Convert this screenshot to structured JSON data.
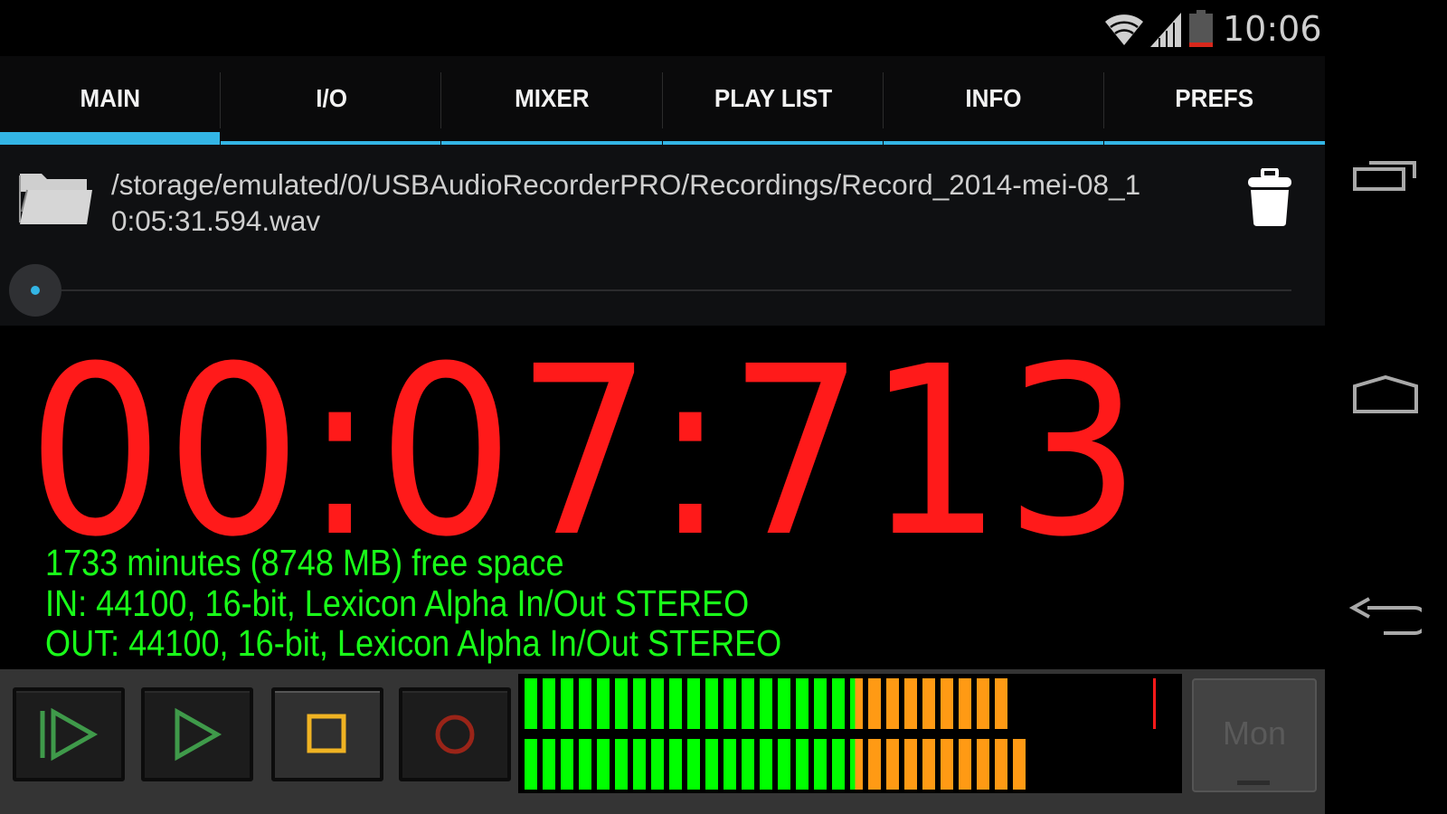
{
  "status_bar": {
    "time": "10:06",
    "icons": [
      "wifi-icon",
      "cell-signal-icon",
      "battery-low-icon"
    ]
  },
  "tabs": [
    {
      "label": "MAIN",
      "active": true
    },
    {
      "label": "I/O",
      "active": false
    },
    {
      "label": "MIXER",
      "active": false
    },
    {
      "label": "PLAY LIST",
      "active": false
    },
    {
      "label": "INFO",
      "active": false
    },
    {
      "label": "PREFS",
      "active": false
    }
  ],
  "file": {
    "path": "/storage/emulated/0/USBAudioRecorderPRO/Recordings/Record_2014-mei-08_10:05:31.594.wav",
    "folder_icon": "folder-icon",
    "delete_icon": "trash-icon",
    "playback_position": 0
  },
  "timer": {
    "display": "00:07:713"
  },
  "info": {
    "free_space": "1733 minutes (8748 MB) free space",
    "input": "IN: 44100, 16-bit, Lexicon Alpha In/Out STEREO",
    "output": "OUT: 44100, 16-bit, Lexicon Alpha In/Out STEREO"
  },
  "transport": [
    {
      "name": "play-from-start-button",
      "icon": "play-from-start-icon",
      "color": "#3f9a4a"
    },
    {
      "name": "play-button",
      "icon": "play-icon",
      "color": "#3f9a4a"
    },
    {
      "name": "stop-button",
      "icon": "stop-icon",
      "color": "#f0b323",
      "active": true
    },
    {
      "name": "record-button",
      "icon": "record-icon",
      "color": "#9a2418"
    }
  ],
  "level_meter": {
    "total_segments": 36,
    "green_segments": 18,
    "channels": [
      {
        "name": "left",
        "lit_segments": 27,
        "peak_segment": 35
      },
      {
        "name": "right",
        "lit_segments": 28,
        "peak_segment": null
      }
    ],
    "colors": {
      "green": "#00ff00",
      "orange": "#ff9a14",
      "peak": "#ff1a1a"
    }
  },
  "monitor_button": {
    "label": "Mon",
    "enabled": false
  },
  "nav_bar": [
    "recent-apps-icon",
    "home-icon",
    "back-icon"
  ],
  "colors": {
    "accent": "#33b5e5",
    "timer": "#ff1a1a",
    "info_text": "#19ff19"
  }
}
